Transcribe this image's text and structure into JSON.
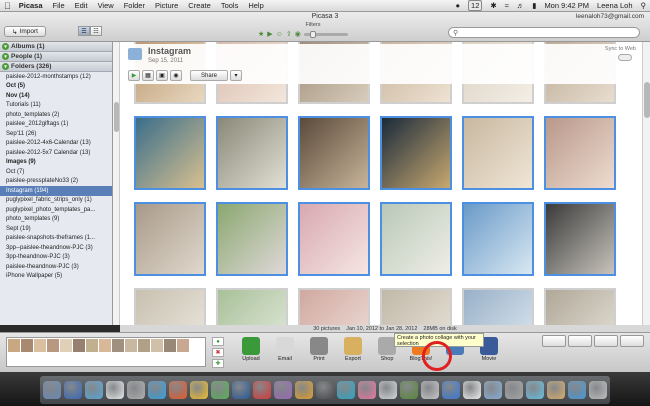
{
  "menubar": {
    "apple": "",
    "app_name": "Picasa",
    "items": [
      "File",
      "Edit",
      "View",
      "Folder",
      "Picture",
      "Create",
      "Tools",
      "Help"
    ],
    "right_badge": "12",
    "clock": "Mon 9:42 PM",
    "user": "Leena Loh"
  },
  "window": {
    "title": "Picasa 3",
    "account": "leenaloh73@gmail.com",
    "import_label": "Import",
    "filters_label": "Filters"
  },
  "sidebar": {
    "sections": [
      {
        "label": "Albums (1)"
      },
      {
        "label": "People (1)"
      },
      {
        "label": "Folders (326)"
      }
    ],
    "folders": [
      {
        "label": "paislee-2012-monthstamps (12)",
        "bold": false
      },
      {
        "label": "Oct (5)",
        "bold": true
      },
      {
        "label": "Nov (14)",
        "bold": true
      },
      {
        "label": "Tutorials (11)",
        "bold": false
      },
      {
        "label": "photo_templates (2)",
        "bold": false
      },
      {
        "label": "paislee_2012giftags (1)",
        "bold": false
      },
      {
        "label": "Sep'11 (26)",
        "bold": false
      },
      {
        "label": "paislee-2012-4x6-Calendar (13)",
        "bold": false
      },
      {
        "label": "paislee-2012-5x7 Calendar (13)",
        "bold": false
      },
      {
        "label": "Images (9)",
        "bold": true
      },
      {
        "label": "Oct (7)",
        "bold": false
      },
      {
        "label": "paislee-pressplateNo33 (2)",
        "bold": false
      },
      {
        "label": "Instagram (194)",
        "bold": false,
        "selected": true
      },
      {
        "label": "puglypixel_fabric_strips_only (1)",
        "bold": false
      },
      {
        "label": "puglypixel_photo_templates_pa...",
        "bold": false
      },
      {
        "label": "photo_templates (9)",
        "bold": false
      },
      {
        "label": "Sept (19)",
        "bold": false
      },
      {
        "label": "paislee-snapshots-theframes (1...",
        "bold": false
      },
      {
        "label": "3pp--paislee-theandnow-PJC (3)",
        "bold": false
      },
      {
        "label": "3pp-theandnow-PJC (3)",
        "bold": false
      },
      {
        "label": "paislee-theandnow-PJC (3)",
        "bold": false
      },
      {
        "label": "iPhone Wallpaper (5)",
        "bold": false
      }
    ]
  },
  "album": {
    "name": "Instagram",
    "date": "Sep 15, 2011",
    "sync_label": "Sync to Web",
    "share_label": "Share"
  },
  "thumbnails": [
    {
      "sel": false,
      "c1": "#b8946a",
      "c2": "#e8d8c0"
    },
    {
      "sel": false,
      "c1": "#d8b8a8",
      "c2": "#f2e6dc"
    },
    {
      "sel": false,
      "c1": "#9a8a74",
      "c2": "#d8ccbc"
    },
    {
      "sel": false,
      "c1": "#c4b098",
      "c2": "#eee2d2"
    },
    {
      "sel": false,
      "c1": "#d9cfc0",
      "c2": "#f4eee6"
    },
    {
      "sel": false,
      "c1": "#b8a890",
      "c2": "#e8ddd0"
    },
    {
      "sel": true,
      "c1": "#3a6e8a",
      "c2": "#d8c090"
    },
    {
      "sel": true,
      "c1": "#8a8878",
      "c2": "#e2e0d4"
    },
    {
      "sel": true,
      "c1": "#5a4a3a",
      "c2": "#c8b49a"
    },
    {
      "sel": true,
      "c1": "#1a2a3a",
      "c2": "#c8a870"
    },
    {
      "sel": true,
      "c1": "#c8b8a0",
      "c2": "#f0e6d6"
    },
    {
      "sel": true,
      "c1": "#b8988a",
      "c2": "#eedcd0"
    },
    {
      "sel": true,
      "c1": "#a89a8a",
      "c2": "#e0d8cc"
    },
    {
      "sel": true,
      "c1": "#8aa870",
      "c2": "#e0d8d8"
    },
    {
      "sel": true,
      "c1": "#d8a8b0",
      "c2": "#f6e6e2"
    },
    {
      "sel": true,
      "c1": "#b8c8b8",
      "c2": "#f0eee6"
    },
    {
      "sel": true,
      "c1": "#6a9ac8",
      "c2": "#d8e8f2"
    },
    {
      "sel": true,
      "c1": "#3a3a3a",
      "c2": "#c8c4bc"
    },
    {
      "sel": false,
      "c1": "#c8c0b0",
      "c2": "#eeeae2"
    },
    {
      "sel": false,
      "c1": "#a8c098",
      "c2": "#e6ece0"
    },
    {
      "sel": false,
      "c1": "#d0a8a0",
      "c2": "#f0e2dc"
    },
    {
      "sel": false,
      "c1": "#c0b8a8",
      "c2": "#ece6dc"
    },
    {
      "sel": false,
      "c1": "#98b0c8",
      "c2": "#e2ebf2"
    },
    {
      "sel": false,
      "c1": "#b0a898",
      "c2": "#e8e4dc"
    }
  ],
  "status_bar": {
    "count": "30 pictures",
    "date_range": "Jan 10, 2012 to Jan 28, 2012",
    "size": "28MB on disk"
  },
  "tray_colors": [
    "#c8a880",
    "#a88a70",
    "#d8c0a0",
    "#b89880",
    "#e0d0b8",
    "#988070",
    "#c0b090",
    "#d8b898",
    "#a09080",
    "#c8b8a0",
    "#b0a088",
    "#d0c0a8",
    "#988878",
    "#c8a890"
  ],
  "actions": [
    {
      "name": "upload",
      "label": "Upload",
      "color": "#3a9a3a"
    },
    {
      "name": "email",
      "label": "Email",
      "color": "#d8d8d8"
    },
    {
      "name": "print",
      "label": "Print",
      "color": "#888888"
    },
    {
      "name": "export",
      "label": "Export",
      "color": "#d8b060"
    },
    {
      "name": "shop",
      "label": "Shop",
      "color": "#aaaaaa"
    },
    {
      "name": "blogthis",
      "label": "BlogThis!",
      "color": "#f07a20"
    },
    {
      "name": "collage",
      "label": "",
      "color": "#4a7ab8"
    },
    {
      "name": "movie",
      "label": "Movie",
      "color": "#3a5a9a"
    }
  ],
  "tooltip": "Create a photo collage with your selection",
  "colors": {
    "selection": "#5a7fb8",
    "thumb_border_selected": "#4d8fe0",
    "highlight_ring": "#e02020"
  },
  "dock_colors": [
    "#6a8ab8",
    "#3a6ab8",
    "#5aa8d8",
    "#e8e8e8",
    "#b0b0b0",
    "#3aa0e0",
    "#e85a2a",
    "#f0c030",
    "#5ab05a",
    "#2a5a9a",
    "#d83a3a",
    "#9a6ab8",
    "#e0a030",
    "#4a4a4a",
    "#30a8c8",
    "#e87aa0",
    "#d8d8d8",
    "#5a8a3a",
    "#c8c8c8",
    "#3a7ad8",
    "#f0f0f0",
    "#8ab0d8",
    "#a8a8a8",
    "#6ac0e0",
    "#d8b070",
    "#4a9ad8",
    "#c0c0c0"
  ]
}
